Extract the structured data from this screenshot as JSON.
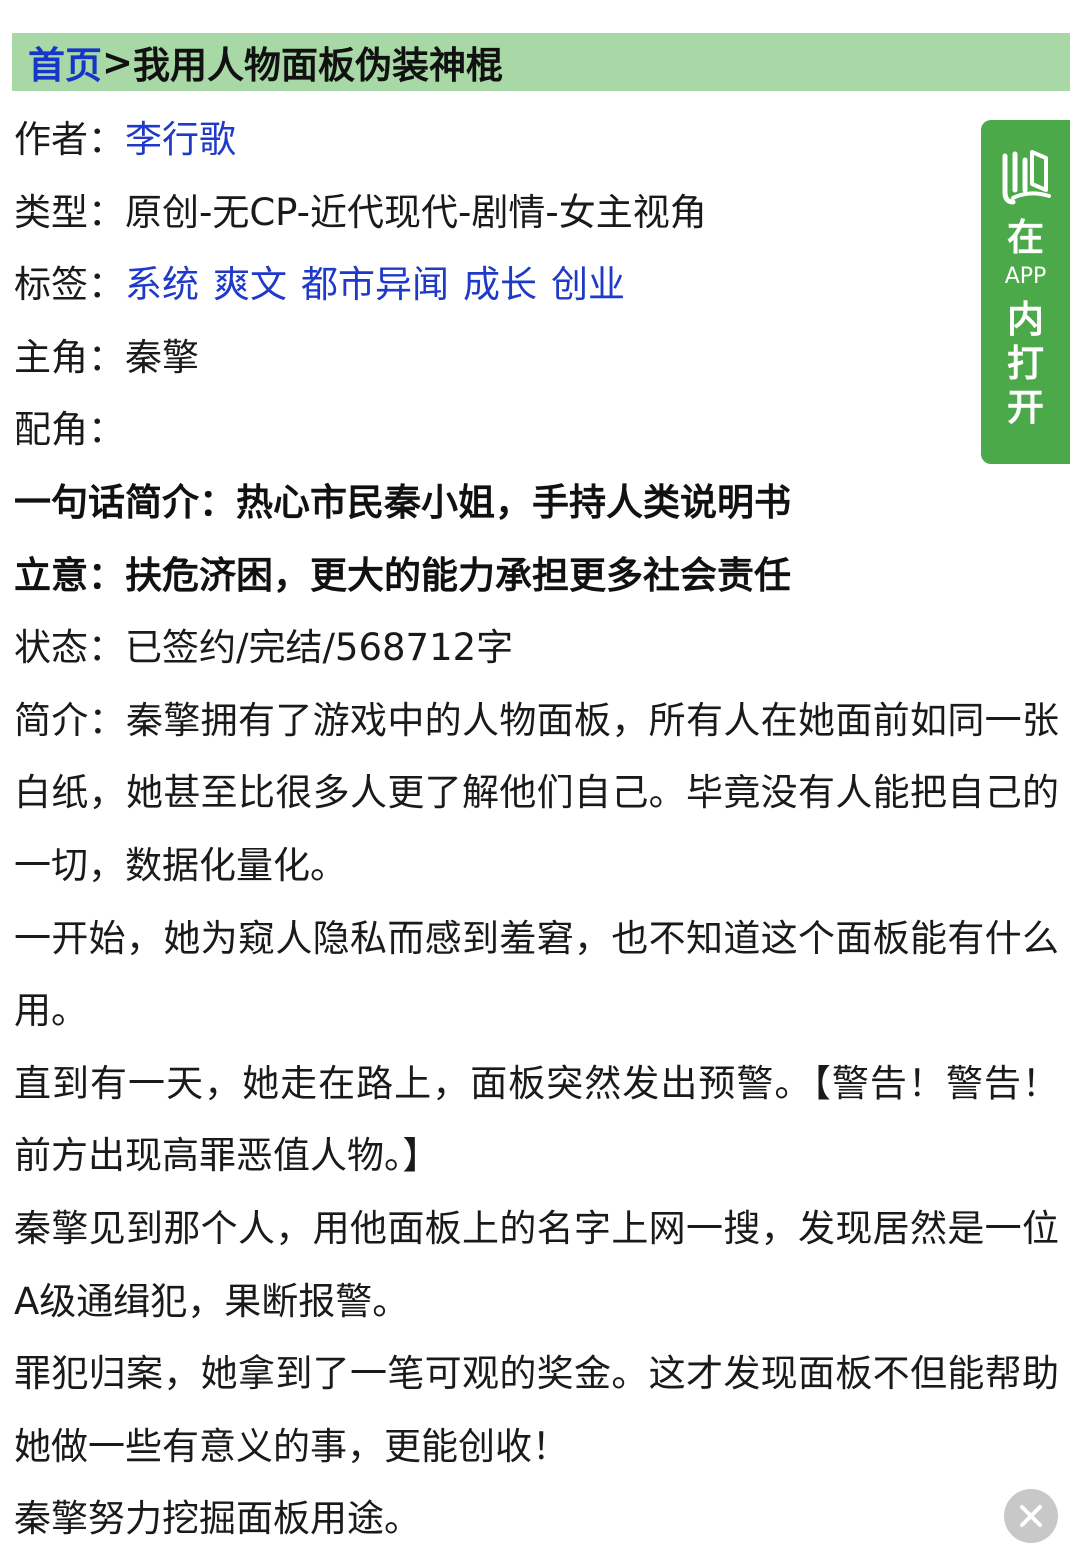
{
  "breadcrumb": {
    "home": "首页",
    "separator": ">",
    "title": "我用人物面板伪装神棍"
  },
  "info": {
    "author_label": "作者：",
    "author": "李行歌",
    "type_label": "类型：",
    "type": "原创-无CP-近代现代-剧情-女主视角",
    "tags_label": "标签：",
    "tags": [
      "系统",
      "爽文",
      "都市异闻",
      "成长",
      "创业"
    ],
    "protagonist_label": "主角：",
    "protagonist": "秦擎",
    "supporting_label": "配角：",
    "supporting": "",
    "oneliner": "一句话简介：热心市民秦小姐，手持人类说明书",
    "theme": "立意：扶危济困，更大的能力承担更多社会责任",
    "status_label": "状态：",
    "status": "已签约/完结/568712字"
  },
  "synopsis": {
    "label": "简介：",
    "paragraphs": [
      "秦擎拥有了游戏中的人物面板，所有人在她面前如同一张白纸，她甚至比很多人更了解他们自己。毕竟没有人能把自己的一切，数据化量化。",
      "一开始，她为窥人隐私而感到羞窘，也不知道这个面板能有什么用。",
      "直到有一天，她走在路上，面板突然发出预警。【警告！警告！前方出现高罪恶值人物。】",
      "秦擎见到那个人，用他面板上的名字上网一搜，发现居然是一位A级通缉犯，果断报警。",
      "罪犯归案，她拿到了一笔可观的奖金。这才发现面板不但能帮助她做一些有意义的事，更能创收！",
      "秦擎努力挖掘面板用途。"
    ]
  },
  "app_button": {
    "char1": "在",
    "small": "APP",
    "char2": "内",
    "char3": "打",
    "char4": "开",
    "logo_icon": "jjwxc-book-logo-icon",
    "color": "#4ba94a"
  },
  "close_button": {
    "icon": "close-icon"
  },
  "colors": {
    "breadcrumb_bg": "#a8d8a6",
    "link": "#1f3ac8"
  }
}
